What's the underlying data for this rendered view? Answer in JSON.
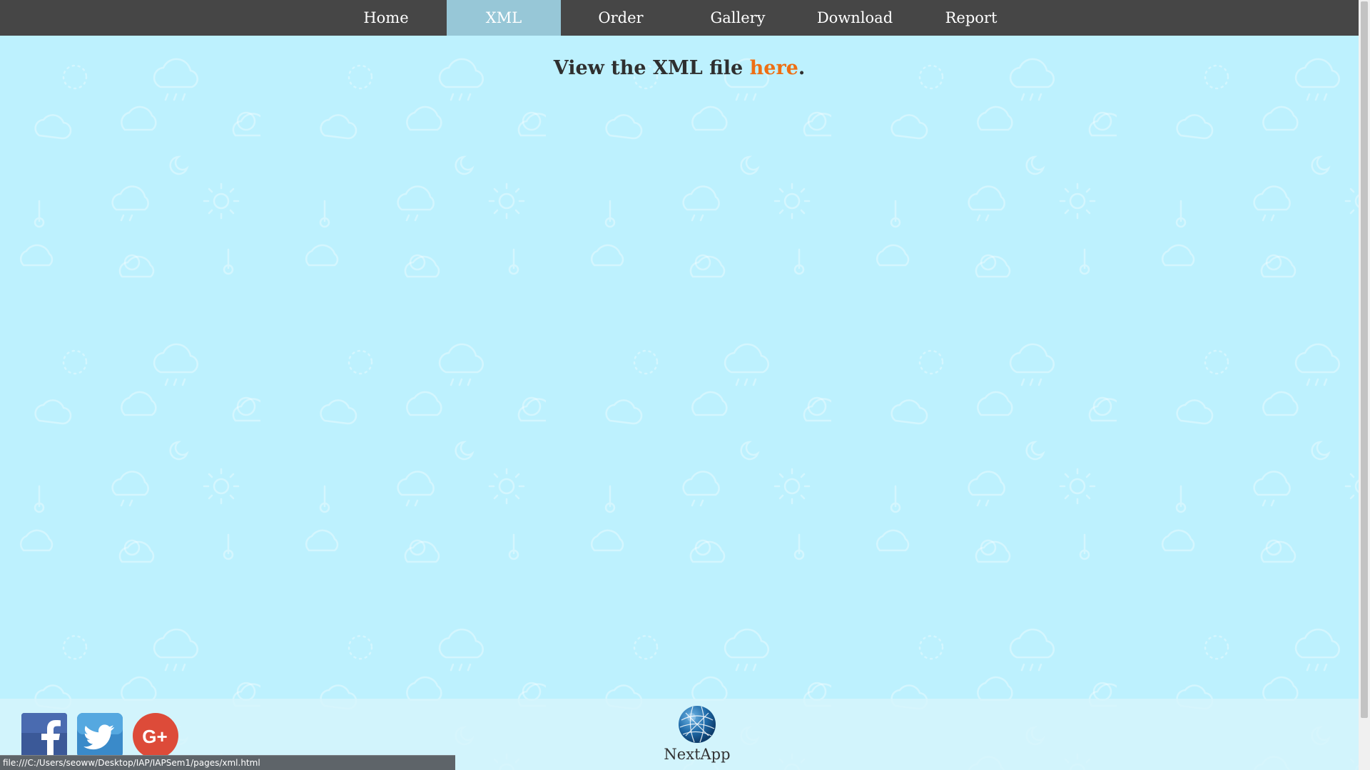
{
  "nav": {
    "items": [
      {
        "label": "Home",
        "active": false
      },
      {
        "label": "XML",
        "active": true
      },
      {
        "label": "Order",
        "active": false
      },
      {
        "label": "Gallery",
        "active": false
      },
      {
        "label": "Download",
        "active": false
      },
      {
        "label": "Report",
        "active": false
      }
    ]
  },
  "main": {
    "heading_prefix": "View the XML file ",
    "heading_link": "here",
    "heading_suffix": "."
  },
  "footer": {
    "brand_name": "NextApp",
    "social": [
      {
        "name": "facebook",
        "glyph": "f"
      },
      {
        "name": "twitter",
        "glyph": ""
      },
      {
        "name": "google-plus",
        "glyph": "G+"
      }
    ]
  },
  "status_bar": {
    "url": "file:///C:/Users/seoww/Desktop/IAP/IAPSem1/pages/xml.html"
  },
  "colors": {
    "nav_bg": "#464646",
    "nav_active": "#97c7d7",
    "page_bg": "#bdf1fe",
    "link": "#ee6f14",
    "facebook": "#3b5998",
    "twitter": "#3a8ac9",
    "google_plus": "#dd4b39"
  },
  "icons": [
    "sun-icon",
    "cloud-icon",
    "moon-icon",
    "thermometer-icon",
    "rain-icon",
    "wind-icon"
  ]
}
